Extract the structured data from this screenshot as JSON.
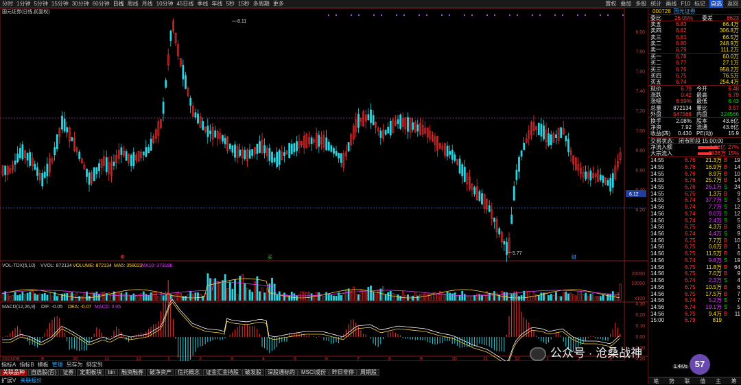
{
  "topbar": {
    "periods": [
      "分时",
      "1分钟",
      "5分钟",
      "15分钟",
      "30分钟",
      "60分钟",
      "日线",
      "周线",
      "月线",
      "10分钟",
      "45日线",
      "季线",
      "年线",
      "5秒",
      "15秒",
      "多周期",
      "更多"
    ],
    "active_period": "日线",
    "right_items": [
      "叠加",
      "多股",
      "统计",
      "画线",
      "F10",
      "标记",
      "自选",
      "返回"
    ],
    "left_first": "置权"
  },
  "chart": {
    "title": "国元证券(日线,前复权)",
    "ylabels_main": [
      "8.00",
      "7.80",
      "7.60",
      "7.40",
      "7.20",
      "7.00",
      "6.80",
      "6.60",
      "6.40",
      "6.20"
    ],
    "price_label": "6.12",
    "max_label": "8.11",
    "min_label": "5.77",
    "marks": {
      "r1": "买",
      "r2": "卖",
      "r3": "财"
    },
    "vol_title": "VOL-TDX(5,10)",
    "vol_vvol": "VVOL: 872134",
    "vol_volume": "VOLUME: 872134",
    "vol_ma5": "MA5: 358022",
    "vol_ma10": "MA10: 373186",
    "vol_yl": [
      "20000",
      "10000",
      "x100"
    ],
    "macd_title": "MACD(12,26,9)",
    "macd_dif": "DIF: -0.05",
    "macd_dea": "DEA: -0.07",
    "macd_macd": "MACD: 0.05",
    "macd_yl": [
      "0.30",
      "0.20",
      "0.10",
      "0.00",
      "-0.10",
      "-0.20"
    ],
    "date_label": "2023/08",
    "months": [
      "9",
      "10",
      "11",
      "12",
      "1",
      "2",
      "3",
      "4",
      "5",
      "6",
      "7",
      "8",
      "9",
      "10",
      "11",
      "12",
      "1",
      "2",
      "3"
    ]
  },
  "bottom": {
    "tabs1": [
      "指标A",
      "指标B",
      "模板",
      "管理",
      "另存为",
      "绑定到"
    ],
    "tabs2": [
      "关联品种",
      "自选股(否)",
      "证券",
      "定期板块",
      "bin",
      "融资融券",
      "破净资产",
      "信托概念",
      "证金汇金持股",
      "破发股",
      "深股通标的",
      "MSCI成份",
      "昨日非停",
      "周期股"
    ],
    "tabs3": [
      "扩展V",
      "关联报价"
    ]
  },
  "quote": {
    "code": "000728",
    "name": "国元证券",
    "ratio_label": "委比",
    "ratio_value": "26.05%",
    "diff_label": "委差",
    "diff_value": "8623",
    "asks": [
      [
        "卖五",
        "6.83",
        "66.4万"
      ],
      [
        "卖四",
        "6.82",
        "306.8万"
      ],
      [
        "卖三",
        "6.81",
        "66.5万"
      ],
      [
        "卖二",
        "6.80",
        "248.9万"
      ],
      [
        "卖一",
        "6.79",
        "111.2万"
      ]
    ],
    "bids": [
      [
        "买一",
        "6.78",
        "60.0万"
      ],
      [
        "买二",
        "6.77",
        "27.1万"
      ],
      [
        "买三",
        "6.76",
        "958.2万"
      ],
      [
        "买四",
        "6.75",
        "76.5万"
      ],
      [
        "买五",
        "6.74",
        "254.4万"
      ]
    ],
    "stats": [
      [
        "现价",
        "6.79",
        "今开",
        "6.48"
      ],
      [
        "涨跌",
        "0.42",
        "最高",
        "6.79"
      ],
      [
        "涨幅",
        "6.59%",
        "最低",
        "6.43"
      ],
      [
        "总量",
        "872134",
        "量比",
        "3.57"
      ],
      [
        "外盘",
        "547568",
        "内盘",
        "324566"
      ]
    ],
    "stats2": [
      [
        "换手",
        "2.08%",
        "股本",
        "43.6亿"
      ],
      [
        "净资",
        "7.92",
        "流通",
        "43.6亿"
      ],
      [
        "收益(四)",
        "0.430",
        "PE(动)",
        "15.9"
      ]
    ],
    "status_label": "交易状态:",
    "status_value": "闭市阶段 15:00:00",
    "flows": [
      [
        "净流入额",
        "1.56亿",
        "27%"
      ],
      [
        "大宗流入",
        "8826万",
        "15%"
      ]
    ],
    "ticks": [
      [
        "14:55",
        "6.76",
        "21.3万",
        "B",
        "19"
      ],
      [
        "14:55",
        "6.76",
        "16.9万",
        "B",
        "14"
      ],
      [
        "14:55",
        "6.76",
        "8.9万",
        "B",
        "10"
      ],
      [
        "14:55",
        "6.76",
        "25.7万",
        "B",
        "14"
      ],
      [
        "14:55",
        "6.76",
        "26.1万",
        "S",
        "24"
      ],
      [
        "14:55",
        "6.75",
        "1.3万",
        "B",
        "9"
      ],
      [
        "14:55",
        "6.74",
        "37.7万",
        "S",
        "5"
      ],
      [
        "14:56",
        "6.74",
        "7.7万",
        "S",
        "12"
      ],
      [
        "14:56",
        "6.74",
        "8.0万",
        "S",
        "12"
      ],
      [
        "14:56",
        "6.74",
        "2.4万",
        "S",
        "5"
      ],
      [
        "14:56",
        "6.75",
        "4.3万",
        "B",
        "8"
      ],
      [
        "14:56",
        "6.74",
        "4.4万",
        "S",
        "9"
      ],
      [
        "14:56",
        "6.75",
        "7.7万",
        "B",
        "10"
      ],
      [
        "14:56",
        "6.75",
        "0.6万",
        "B",
        "1"
      ],
      [
        "14:56",
        "6.75",
        "11.5万",
        "B",
        "6"
      ],
      [
        "14:56",
        "6.74",
        "9.8万",
        "S",
        "19"
      ],
      [
        "14:56",
        "6.75",
        "11.8万",
        "B",
        "64"
      ],
      [
        "14:56",
        "6.75",
        "7.0万",
        "B",
        "9"
      ],
      [
        "14:56",
        "6.74",
        "2.3万",
        "S",
        "4"
      ],
      [
        "14:56",
        "6.75",
        "10.5万",
        "B",
        "6"
      ],
      [
        "14:56",
        "6.75",
        "17.5万",
        "B",
        "7"
      ],
      [
        "14:56",
        "6.74",
        "5.2万",
        "S",
        "7"
      ],
      [
        "14:56",
        "6.74",
        "19.1万",
        "S",
        "5"
      ],
      [
        "14:56",
        "6.75",
        "9.4万",
        "B",
        "11"
      ],
      [
        "15:00",
        "6.79",
        "819",
        "",
        ""
      ]
    ],
    "footer": [
      "笔",
      "势",
      "联",
      "值",
      "主",
      "筹"
    ]
  },
  "watermark": {
    "text": "公众号 · 沧桑战神",
    "speed": "57",
    "speed_sub": "1.4K/s"
  },
  "chart_data": {
    "type": "candlestick",
    "title": "国元证券(日线,前复权)",
    "ylim": [
      5.7,
      8.2
    ],
    "annotated_high": 8.11,
    "annotated_low": 5.77,
    "last_close": 6.79,
    "current_marker": 6.12
  }
}
